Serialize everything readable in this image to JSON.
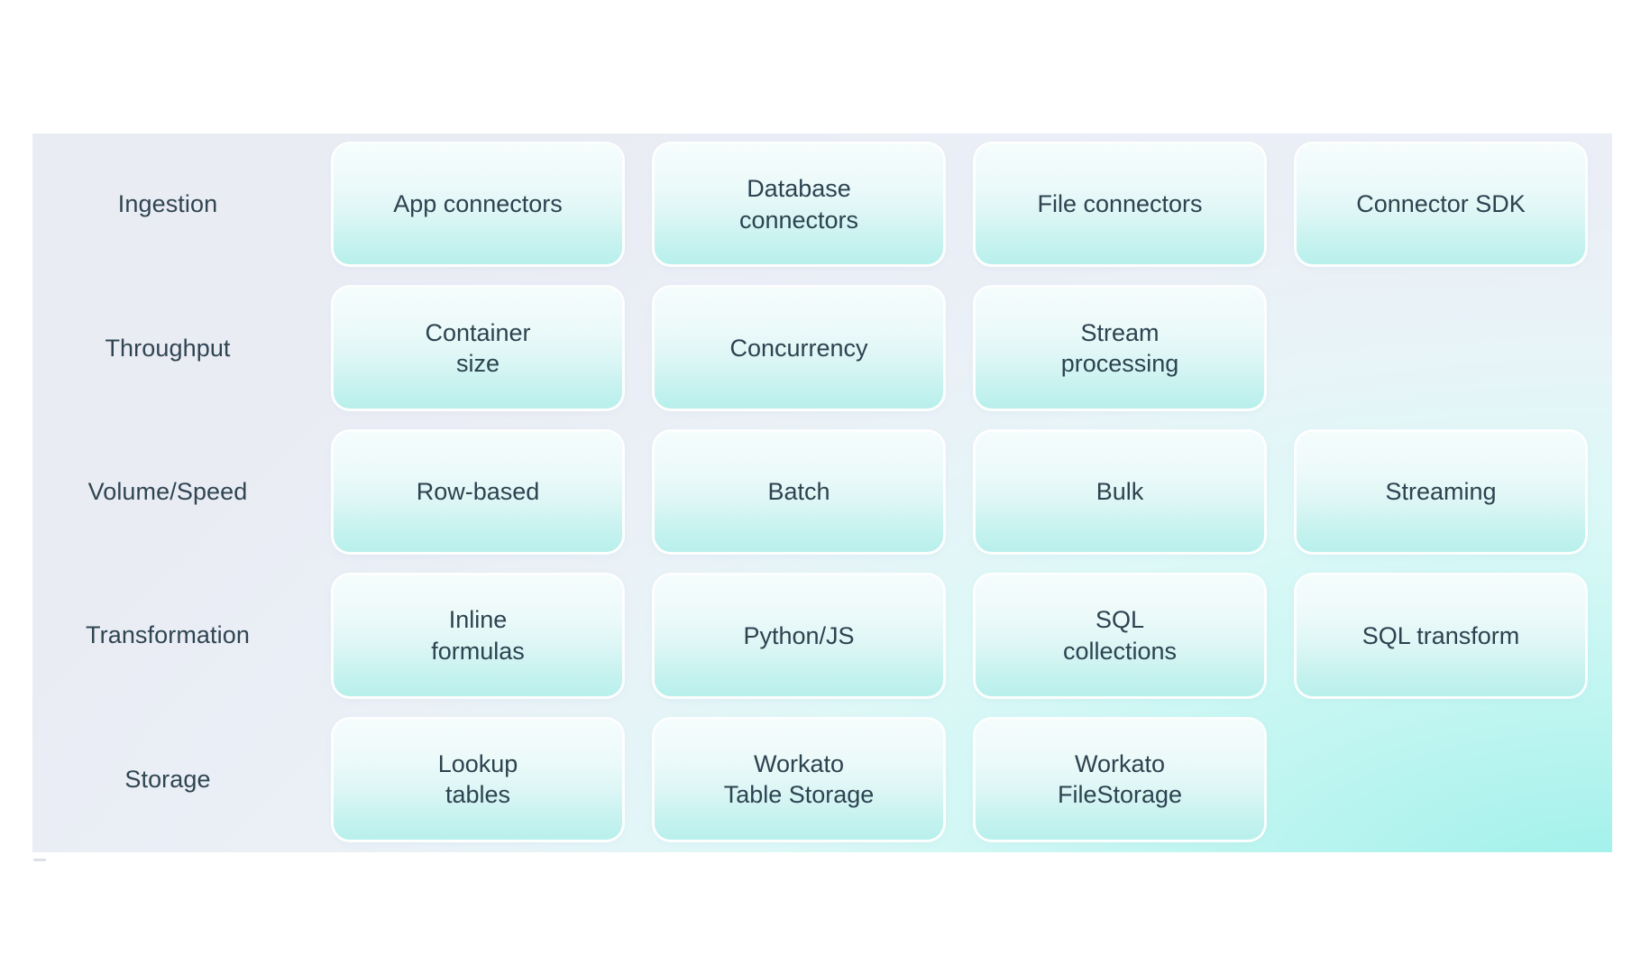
{
  "panel": {
    "label_column_header": "",
    "background_colors": {
      "top_left": "#eaecf4",
      "bottom_right": "#9ef0ea",
      "card_top": "#f4fcfc",
      "card_bottom": "#b8f0ec",
      "text": "#2c4350"
    }
  },
  "rows": [
    {
      "label": "Ingestion",
      "cards": [
        {
          "label": "App connectors",
          "empty": false
        },
        {
          "label": "Database\nconnectors",
          "empty": false
        },
        {
          "label": "File connectors",
          "empty": false
        },
        {
          "label": "Connector SDK",
          "empty": false
        }
      ]
    },
    {
      "label": "Throughput",
      "cards": [
        {
          "label": "Container\nsize",
          "empty": false
        },
        {
          "label": "Concurrency",
          "empty": false
        },
        {
          "label": "Stream\nprocessing",
          "empty": false
        },
        {
          "label": "",
          "empty": true
        }
      ]
    },
    {
      "label": "Volume/Speed",
      "cards": [
        {
          "label": "Row-based",
          "empty": false
        },
        {
          "label": "Batch",
          "empty": false
        },
        {
          "label": "Bulk",
          "empty": false
        },
        {
          "label": "Streaming",
          "empty": false
        }
      ]
    },
    {
      "label": "Transformation",
      "cards": [
        {
          "label": "Inline\nformulas",
          "empty": false
        },
        {
          "label": "Python/JS",
          "empty": false
        },
        {
          "label": "SQL\ncollections",
          "empty": false
        },
        {
          "label": "SQL transform",
          "empty": false
        }
      ]
    },
    {
      "label": "Storage",
      "cards": [
        {
          "label": "Lookup\ntables",
          "empty": false
        },
        {
          "label": "Workato\nTable Storage",
          "empty": false
        },
        {
          "label": "Workato\nFileStorage",
          "empty": false
        },
        {
          "label": "",
          "empty": true
        }
      ]
    }
  ]
}
